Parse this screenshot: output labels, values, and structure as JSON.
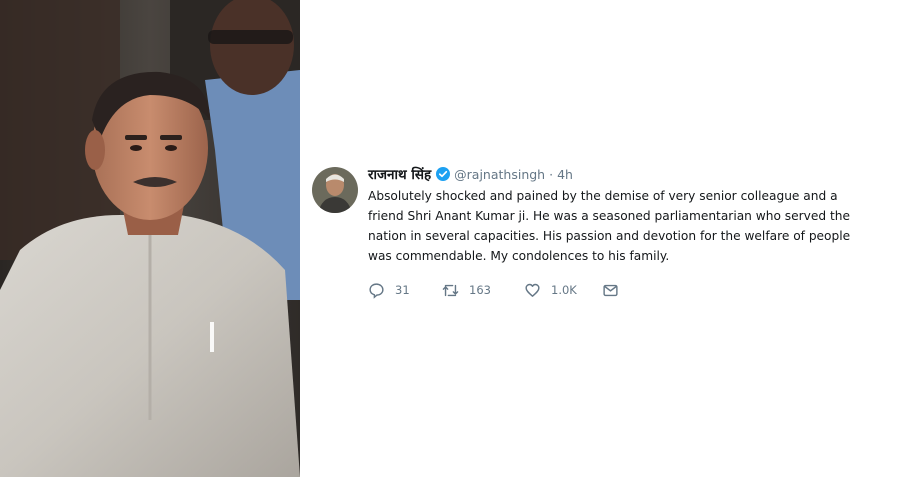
{
  "photo": {
    "description_icon": "person-photo"
  },
  "tweet": {
    "display_name": "राजनाथ सिंह",
    "handle": "@rajnathsingh",
    "separator": "·",
    "time": "4h",
    "text_lines": [
      "Absolutely shocked and pained by the demise of very senior colleague and a",
      "friend Shri Anant Kumar ji. He was a seasoned parliamentarian who served the",
      "nation in several capacities. His passion and devotion for the welfare of people",
      "was commendable. My condolences to his family."
    ],
    "actions": {
      "reply_count": "31",
      "retweet_count": "163",
      "like_count": "1.0K"
    }
  },
  "colors": {
    "text": "#14171a",
    "muted": "#657786",
    "verified": "#1da1f2"
  }
}
